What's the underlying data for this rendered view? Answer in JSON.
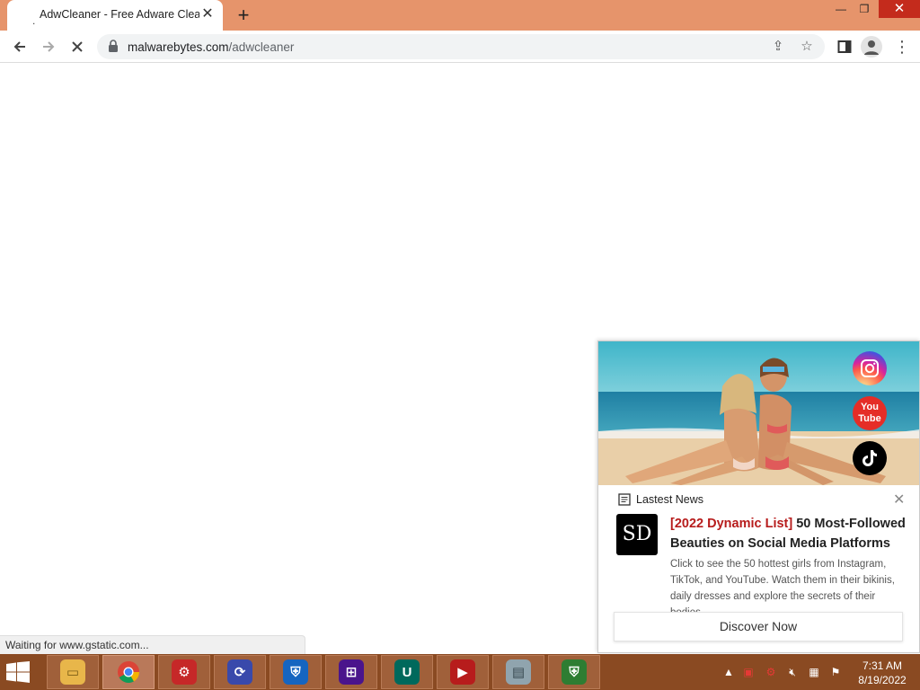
{
  "browser": {
    "tab": {
      "title": "AdwCleaner - Free Adware Clean",
      "loading_glyph": "."
    },
    "url": {
      "host": "malwarebytes.com",
      "path": "/adwcleaner"
    },
    "status_text": "Waiting for www.gstatic.com..."
  },
  "ad": {
    "header_label": "Lastest News",
    "logo_text": "SD",
    "title_highlight": "[2022 Dynamic List]",
    "title_rest": " 50 Most-Followed Beauties on Social Media Platforms",
    "description": "Click to see the 50 hottest girls from Instagram, TikTok, and YouTube. Watch them in their bikinis, daily dresses and explore the secrets of their bodies.",
    "cta_label": "Discover Now",
    "social_icons": [
      "instagram-icon",
      "youtube-icon",
      "tiktok-icon"
    ],
    "youtube_label": "You\nTube"
  },
  "taskbar": {
    "apps": [
      {
        "name": "file-explorer",
        "color": "#e8b64a"
      },
      {
        "name": "chrome",
        "color": "#ffffff"
      },
      {
        "name": "app-red-gear",
        "color": "#c62828"
      },
      {
        "name": "app-photo-restore",
        "color": "#3949ab"
      },
      {
        "name": "app-shield-blue",
        "color": "#1565c0"
      },
      {
        "name": "app-purple-windows",
        "color": "#4a148c"
      },
      {
        "name": "app-u-circle",
        "color": "#00695c"
      },
      {
        "name": "app-video-recorder",
        "color": "#b71c1c"
      },
      {
        "name": "app-monitor",
        "color": "#90a4ae"
      },
      {
        "name": "app-shield-green",
        "color": "#2e7d32"
      }
    ],
    "time": "7:31 AM",
    "date": "8/19/2022"
  },
  "colors": {
    "titlebar": "#e6946b",
    "taskbar": "#8a4a22",
    "close_red": "#c42b1c",
    "ad_highlight": "#b71c1c"
  }
}
